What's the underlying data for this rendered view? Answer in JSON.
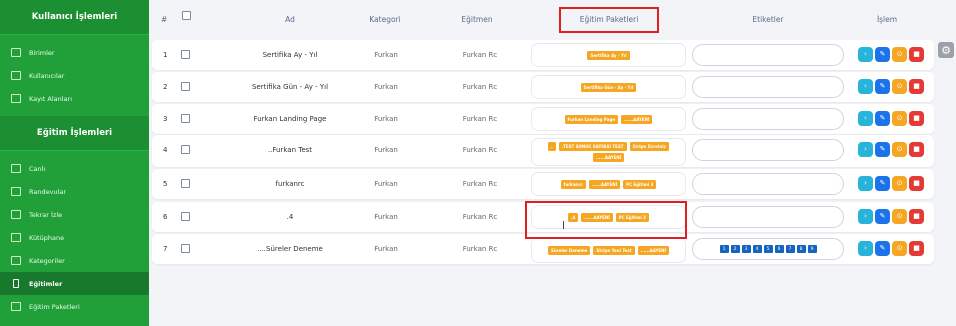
{
  "sidebar": {
    "user_section_title": "Kullanıcı İşlemleri",
    "user_items": [
      {
        "label": "Birimler",
        "icon": "list-icon"
      },
      {
        "label": "Kullanıcılar",
        "icon": "user-icon"
      },
      {
        "label": "Kayıt Alanları",
        "icon": "table-icon"
      }
    ],
    "edu_section_title": "Eğitim İşlemleri",
    "edu_items": [
      {
        "label": "Canlı",
        "icon": "tv-icon"
      },
      {
        "label": "Randevular",
        "icon": "calendar-icon"
      },
      {
        "label": "Tekrar İzle",
        "icon": "video-icon"
      },
      {
        "label": "Kütüphane",
        "icon": "library-icon"
      },
      {
        "label": "Kategoriler",
        "icon": "folder-icon"
      },
      {
        "label": "Eğitimler",
        "icon": "book-icon",
        "active": true
      },
      {
        "label": "Eğitim Paketleri",
        "icon": "package-icon"
      }
    ]
  },
  "table": {
    "headers": {
      "num": "#",
      "ad": "Ad",
      "kategori": "Kategori",
      "egitmen": "Eğitmen",
      "paket": "Eğitim Paketleri",
      "etiket": "Etiketler",
      "islem": "İşlem"
    },
    "rows": [
      {
        "num": "1",
        "ad": "Sertifika Ay - Yıl",
        "kategori": "Furkan",
        "egitmen": "Furkan Rc",
        "paketler": [
          "Sertifika Ay - Yıl"
        ],
        "etiketler": []
      },
      {
        "num": "2",
        "ad": "Sertifika Gün - Ay - Yıl",
        "kategori": "Furkan",
        "egitmen": "Furkan Rc",
        "paketler": [
          "Sertifika Gün - Ay - Yıl"
        ],
        "etiketler": []
      },
      {
        "num": "3",
        "ad": "Furkan Landing Page",
        "kategori": "Furkan",
        "egitmen": "Furkan Rc",
        "paketler": [
          "Furkan Landing Page",
          "......AAYENİ"
        ],
        "etiketler": []
      },
      {
        "num": "4",
        "ad": "..Furkan Test",
        "kategori": "Furkan",
        "egitmen": "Furkan Rc",
        "paketler": [
          ".",
          ".TEST SONUC SAYFASI TEST",
          "Stripe Ücretsiz",
          "......AAYENİ"
        ],
        "etiketler": []
      },
      {
        "num": "5",
        "ad": "furkanrc",
        "kategori": "Furkan",
        "egitmen": "Furkan Rc",
        "paketler": [
          "furkanrc",
          "......AAYENİ",
          "PC Eğitimi 3"
        ],
        "etiketler": []
      },
      {
        "num": "6",
        "ad": ".4",
        "kategori": "Furkan",
        "egitmen": "Furkan Rc",
        "paketler": [
          ".4",
          "......AAYENİ",
          "PC Eğitimi 3"
        ],
        "etiketler": []
      },
      {
        "num": "7",
        "ad": "....Süreler Deneme",
        "kategori": "Furkan",
        "egitmen": "Furkan Rc",
        "paketler": [
          "Süreler Deneme",
          "Stripe Yeni Test",
          "......AAYENİ"
        ],
        "etiketler": [
          "1",
          "2",
          "3",
          "4",
          "5",
          "6",
          "7",
          "8",
          "9"
        ]
      }
    ]
  },
  "colors": {
    "sidebar": "#21a03a",
    "tag": "#f5a623",
    "highlight": "#e02020",
    "etiket": "#1565c0"
  }
}
